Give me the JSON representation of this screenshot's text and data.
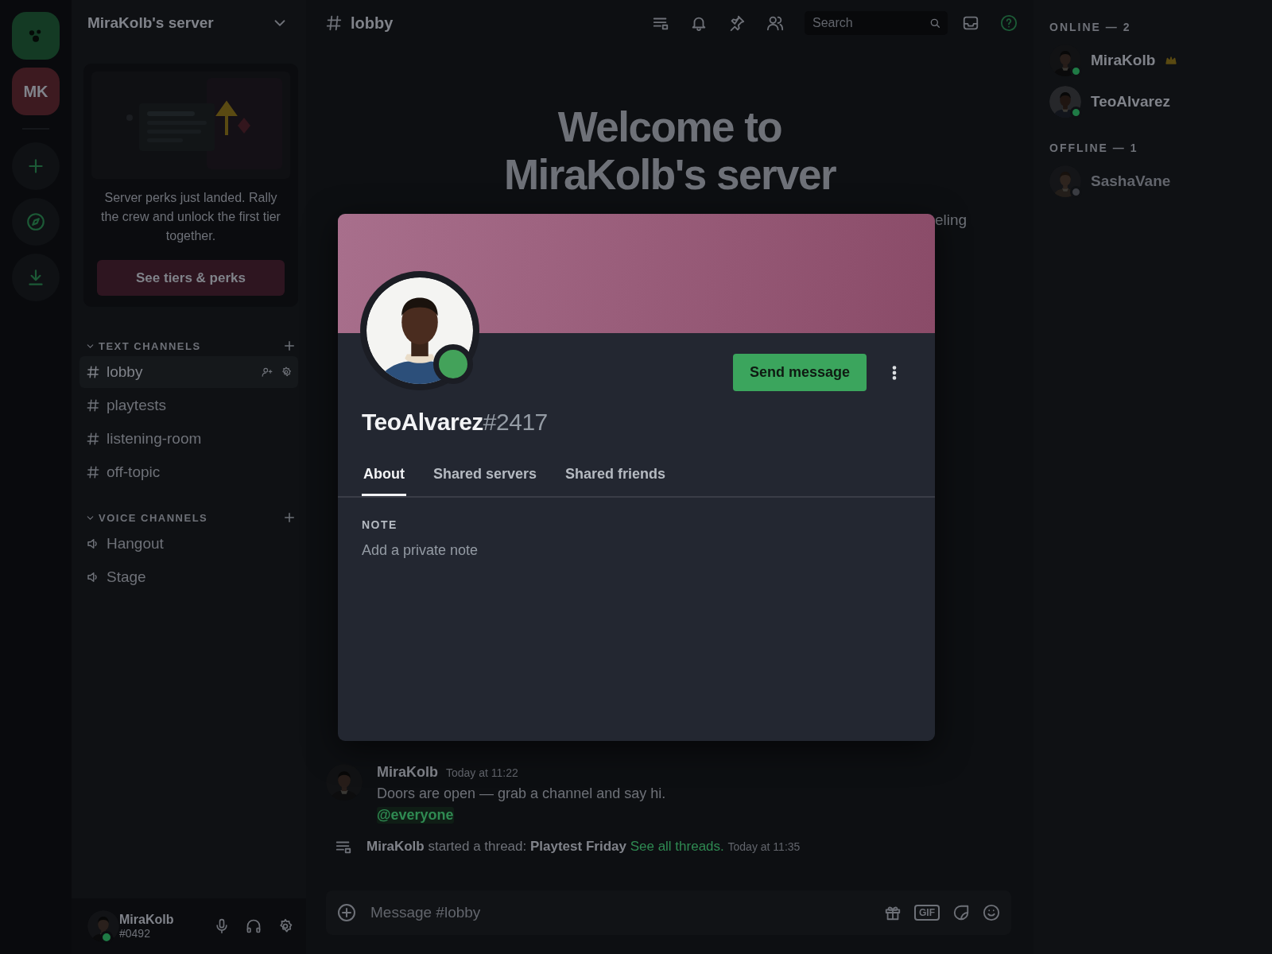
{
  "server_rail": {
    "servers": [
      {
        "kind": "home"
      },
      {
        "kind": "initials",
        "label": "MK"
      }
    ],
    "actions": [
      {
        "kind": "add"
      },
      {
        "kind": "explore"
      },
      {
        "kind": "download"
      }
    ]
  },
  "channel_sidebar": {
    "server_name": "MiraKolb's server",
    "boost_card": {
      "text": "Server perks just landed. Rally the crew and unlock the first tier together.",
      "button": "See tiers & perks"
    },
    "categories": [
      {
        "name": "TEXT CHANNELS",
        "kind": "text",
        "expanded": true,
        "channels": [
          {
            "name": "lobby",
            "selected": true
          },
          {
            "name": "playtests",
            "selected": false
          },
          {
            "name": "listening-room",
            "selected": false
          },
          {
            "name": "off-topic",
            "selected": false
          }
        ]
      },
      {
        "name": "VOICE CHANNELS",
        "kind": "voice",
        "expanded": true,
        "channels": [
          {
            "name": "Hangout",
            "selected": false
          },
          {
            "name": "Stage",
            "selected": false
          }
        ]
      }
    ],
    "user_panel": {
      "name": "MiraKolb",
      "tag": "#0492",
      "color": "#1f7a45"
    }
  },
  "header": {
    "channel": "lobby",
    "search_placeholder": "Search"
  },
  "welcome": {
    "title_lines": [
      "Welcome to",
      "MiraKolb's server"
    ],
    "subtitle_visible": "eling"
  },
  "messages": [
    {
      "author": "MiraKolb",
      "time": "Today at 11:22",
      "text": "Doors are open — grab a channel and say hi.",
      "mention": "@everyone"
    }
  ],
  "system_message": {
    "text": "**MiraKolb** started a thread: **Playtest Friday**",
    "link": "See all threads.",
    "time": "Today at 11:35"
  },
  "composer": {
    "placeholder": "Message #lobby",
    "gif_label": "GIF"
  },
  "member_list": {
    "groups": [
      {
        "label": "ONLINE — 2",
        "members": [
          {
            "name": "MiraKolb",
            "color": "#1f7a45",
            "owner": true
          },
          {
            "name": "TeoAlvarez",
            "color": "#1f7a45",
            "owner": false
          }
        ]
      },
      {
        "label": "OFFLINE — 1",
        "members": [
          {
            "name": "SashaVane",
            "color": "#3a3c42",
            "owner": false
          }
        ]
      }
    ]
  },
  "profile_modal": {
    "username": "TeoAlvarez",
    "discriminator": "#2417",
    "color": "#43a25a",
    "button": "Send message",
    "tabs": [
      {
        "label": "About",
        "selected": true
      },
      {
        "label": "Shared servers",
        "selected": false
      },
      {
        "label": "Shared friends",
        "selected": false
      }
    ],
    "note_label": "NOTE",
    "note_placeholder": "Add a private note"
  }
}
